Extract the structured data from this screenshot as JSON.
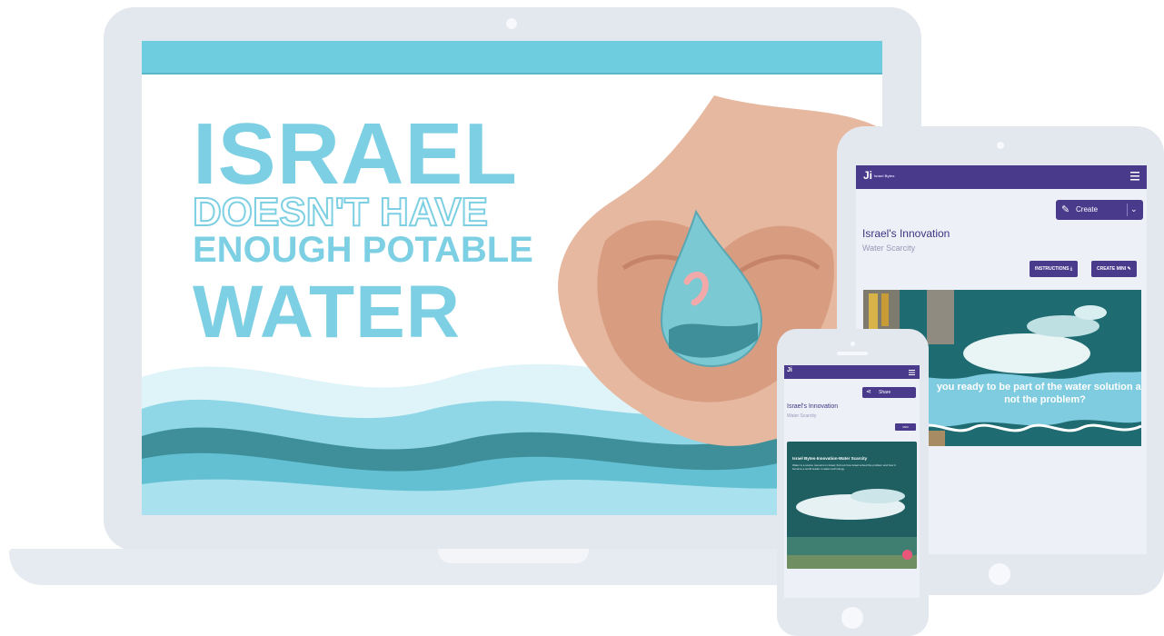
{
  "laptop": {
    "hero": {
      "line1": "ISRAEL",
      "line2": "DOESN'T HAVE",
      "line3": "ENOUGH POTABLE",
      "line4": "WATER"
    },
    "colors": {
      "accent": "#7dd0e3",
      "wave_dark": "#3e8f9a",
      "wave_light": "#a9e2ee"
    }
  },
  "tablet": {
    "nav": {
      "logo": "Ji",
      "logo_text": "Israel Bytes",
      "menu_icon": "hamburger-icon"
    },
    "create_button": {
      "label": "Create",
      "icon": "edit-icon",
      "dropdown_icon": "chevron-down-icon"
    },
    "title": "Israel's Innovation",
    "subtitle": "Water Scarcity",
    "instructions_button": "INSTRUCTIONS",
    "create_mini_button": "CREATE MINI",
    "banner_text": "you ready to be part of the water solution and not the problem?"
  },
  "phone": {
    "nav": {
      "logo": "Ji",
      "menu_icon": "hamburger-icon"
    },
    "share_button": {
      "label": "Share",
      "icon": "share-icon"
    },
    "title": "Israel's Innovation",
    "subtitle": "Water Scarcity",
    "mini_button": "MINI",
    "card": {
      "title": "Israel Bytes-Innovation-Water Scarcity",
      "desc": "Water is a scarce resource in Israel; find out how Israel solved the problem and how it became a world leader in water technology."
    }
  },
  "colors": {
    "brand_purple": "#4a3a8c",
    "device_frame": "#e3e8ef",
    "fab_pink": "#e8577a"
  }
}
